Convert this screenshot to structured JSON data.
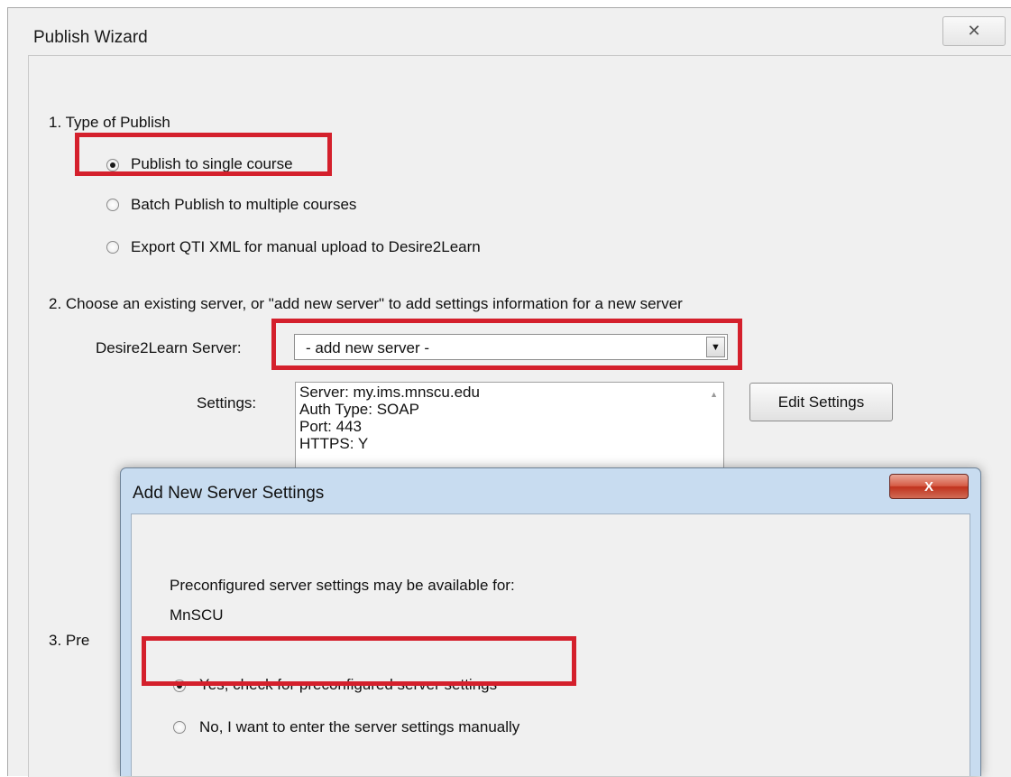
{
  "wizard": {
    "title": "Publish Wizard",
    "close_symbol": "✕",
    "section1": {
      "heading": "1. Type of Publish",
      "options": [
        {
          "label": "Publish to single course",
          "checked": true
        },
        {
          "label": "Batch Publish to multiple courses",
          "checked": false
        },
        {
          "label": "Export QTI XML for manual upload to Desire2Learn",
          "checked": false
        }
      ]
    },
    "section2": {
      "heading": "2. Choose an existing server, or \"add new server\" to add settings information for a new server",
      "server_label": "Desire2Learn Server:",
      "server_value": "- add new server -",
      "settings_label": "Settings:",
      "settings_lines": [
        "Server: my.ims.mnscu.edu",
        "Auth Type: SOAP",
        "Port: 443",
        "HTTPS: Y"
      ],
      "edit_button": "Edit Settings"
    },
    "section3": {
      "heading_partial": "3. Pre"
    }
  },
  "dialog": {
    "title": "Add New Server Settings",
    "close_symbol": "X",
    "message": "Preconfigured server settings may be available for:",
    "org": "MnSCU",
    "options": [
      {
        "label": "Yes, check for preconfigured server settings",
        "checked": true
      },
      {
        "label": "No, I want to enter the server settings manually",
        "checked": false
      }
    ]
  },
  "highlight_color": "#d4202c"
}
